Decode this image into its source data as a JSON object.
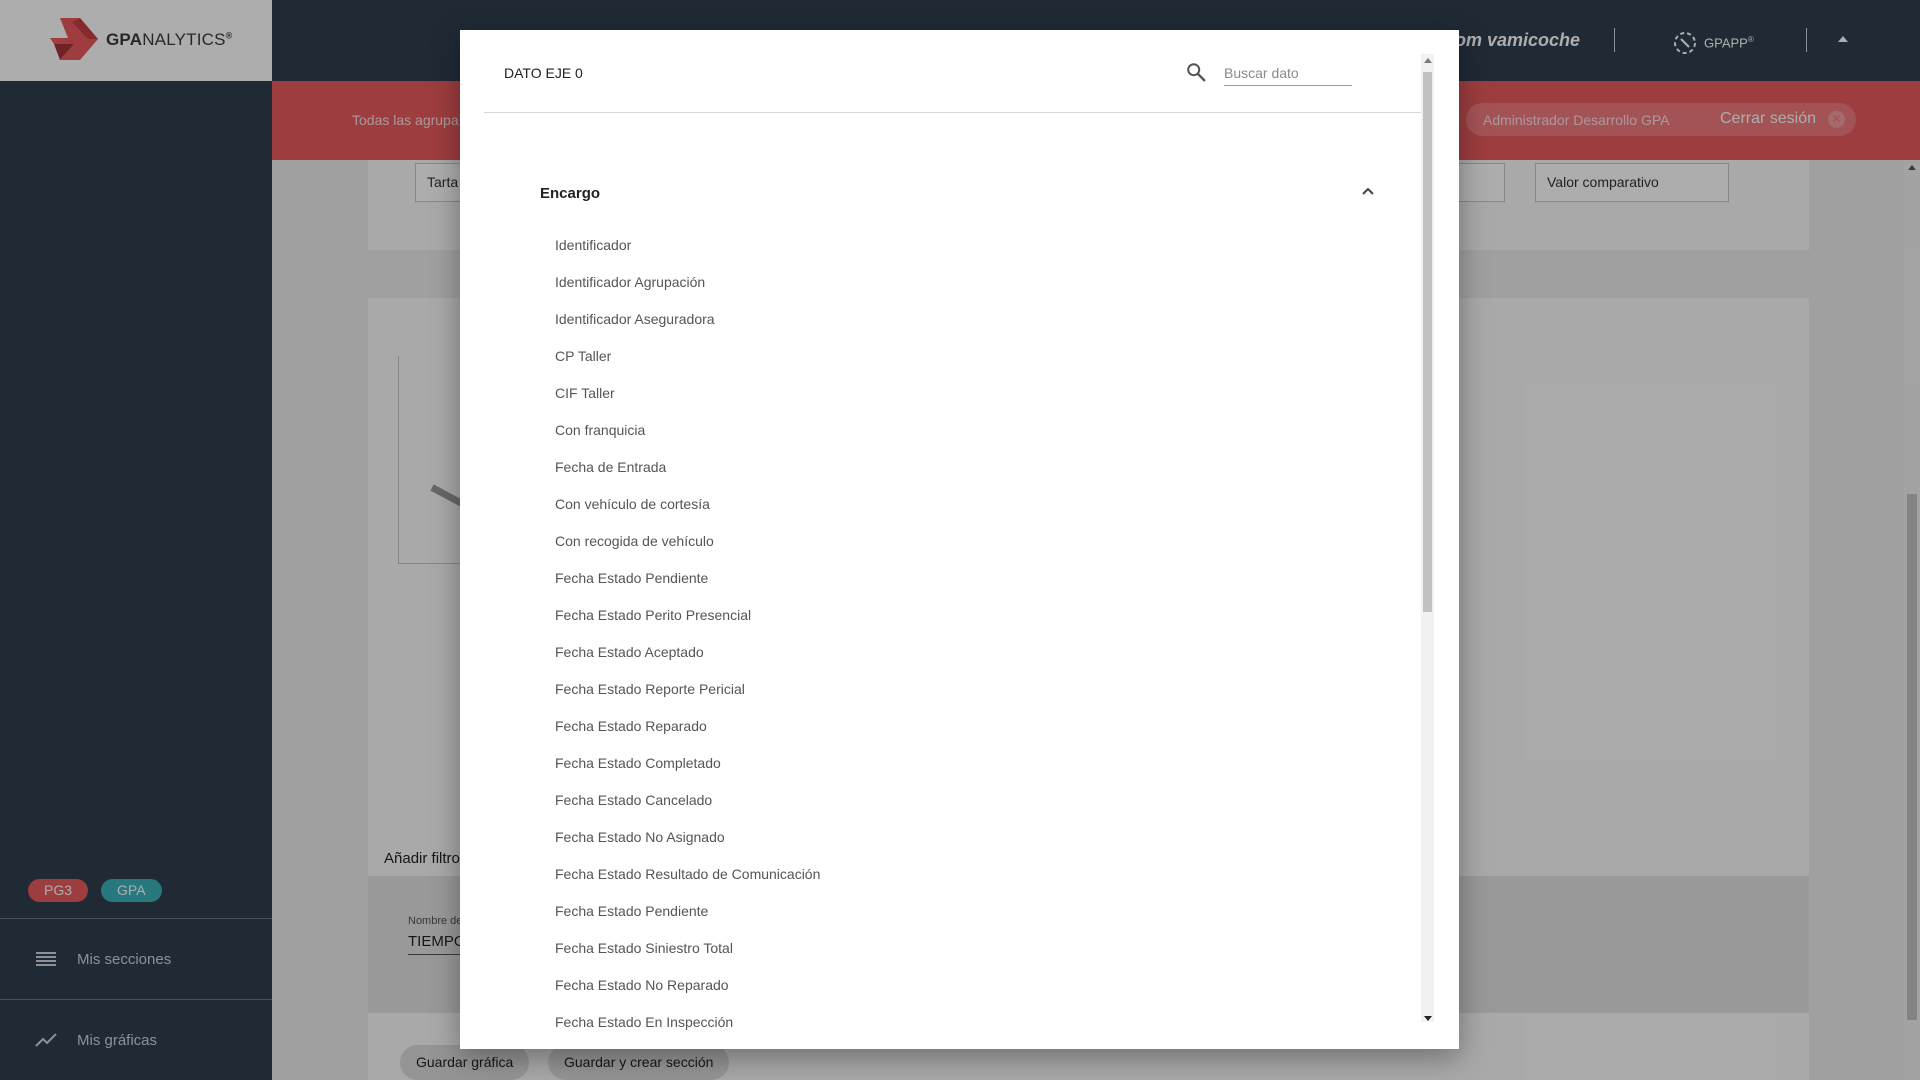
{
  "app": {
    "logo_bold": "GPA",
    "logo_light": "NALYTICS",
    "logo_reg": "®",
    "brand_vamicoche": "om vamicoche",
    "brand_gpapp": "GPAPP",
    "gpapp_reg": "®"
  },
  "sidebar": {
    "tags": [
      "PG3",
      "GPA"
    ],
    "items": [
      {
        "label": "Mis secciones",
        "icon": "list-icon"
      },
      {
        "label": "Mis gráficas",
        "icon": "trending-line-icon"
      }
    ]
  },
  "header": {
    "breadcrumb": "Todas las agrupa",
    "user": "Administrador Desarrollo GPA",
    "logout": "Cerrar sesión"
  },
  "editor": {
    "chart_type_value": "Tarta",
    "comparative_value": "Valor comparativo",
    "add_filter": "Añadir filtro",
    "name_label": "Nombre de",
    "name_value": "TIEMPO",
    "save_button": "Guardar gráfica",
    "save_create_button": "Guardar y crear sección"
  },
  "modal": {
    "title": "DATO EJE 0",
    "search_placeholder": "Buscar dato",
    "group": {
      "title": "Encargo",
      "expanded": true,
      "items": [
        "Identificador",
        "Identificador Agrupación",
        "Identificador Aseguradora",
        "CP Taller",
        "CIF Taller",
        "Con franquicia",
        "Fecha de Entrada",
        "Con vehículo de cortesía",
        "Con recogida de vehículo",
        "Fecha Estado Pendiente",
        "Fecha Estado Perito Presencial",
        "Fecha Estado Aceptado",
        "Fecha Estado Reporte Pericial",
        "Fecha Estado Reparado",
        "Fecha Estado Completado",
        "Fecha Estado Cancelado",
        "Fecha Estado No Asignado",
        "Fecha Estado Resultado de Comunicación",
        "Fecha Estado Pendiente",
        "Fecha Estado Siniestro Total",
        "Fecha Estado No Reparado",
        "Fecha Estado En Inspección"
      ]
    }
  }
}
